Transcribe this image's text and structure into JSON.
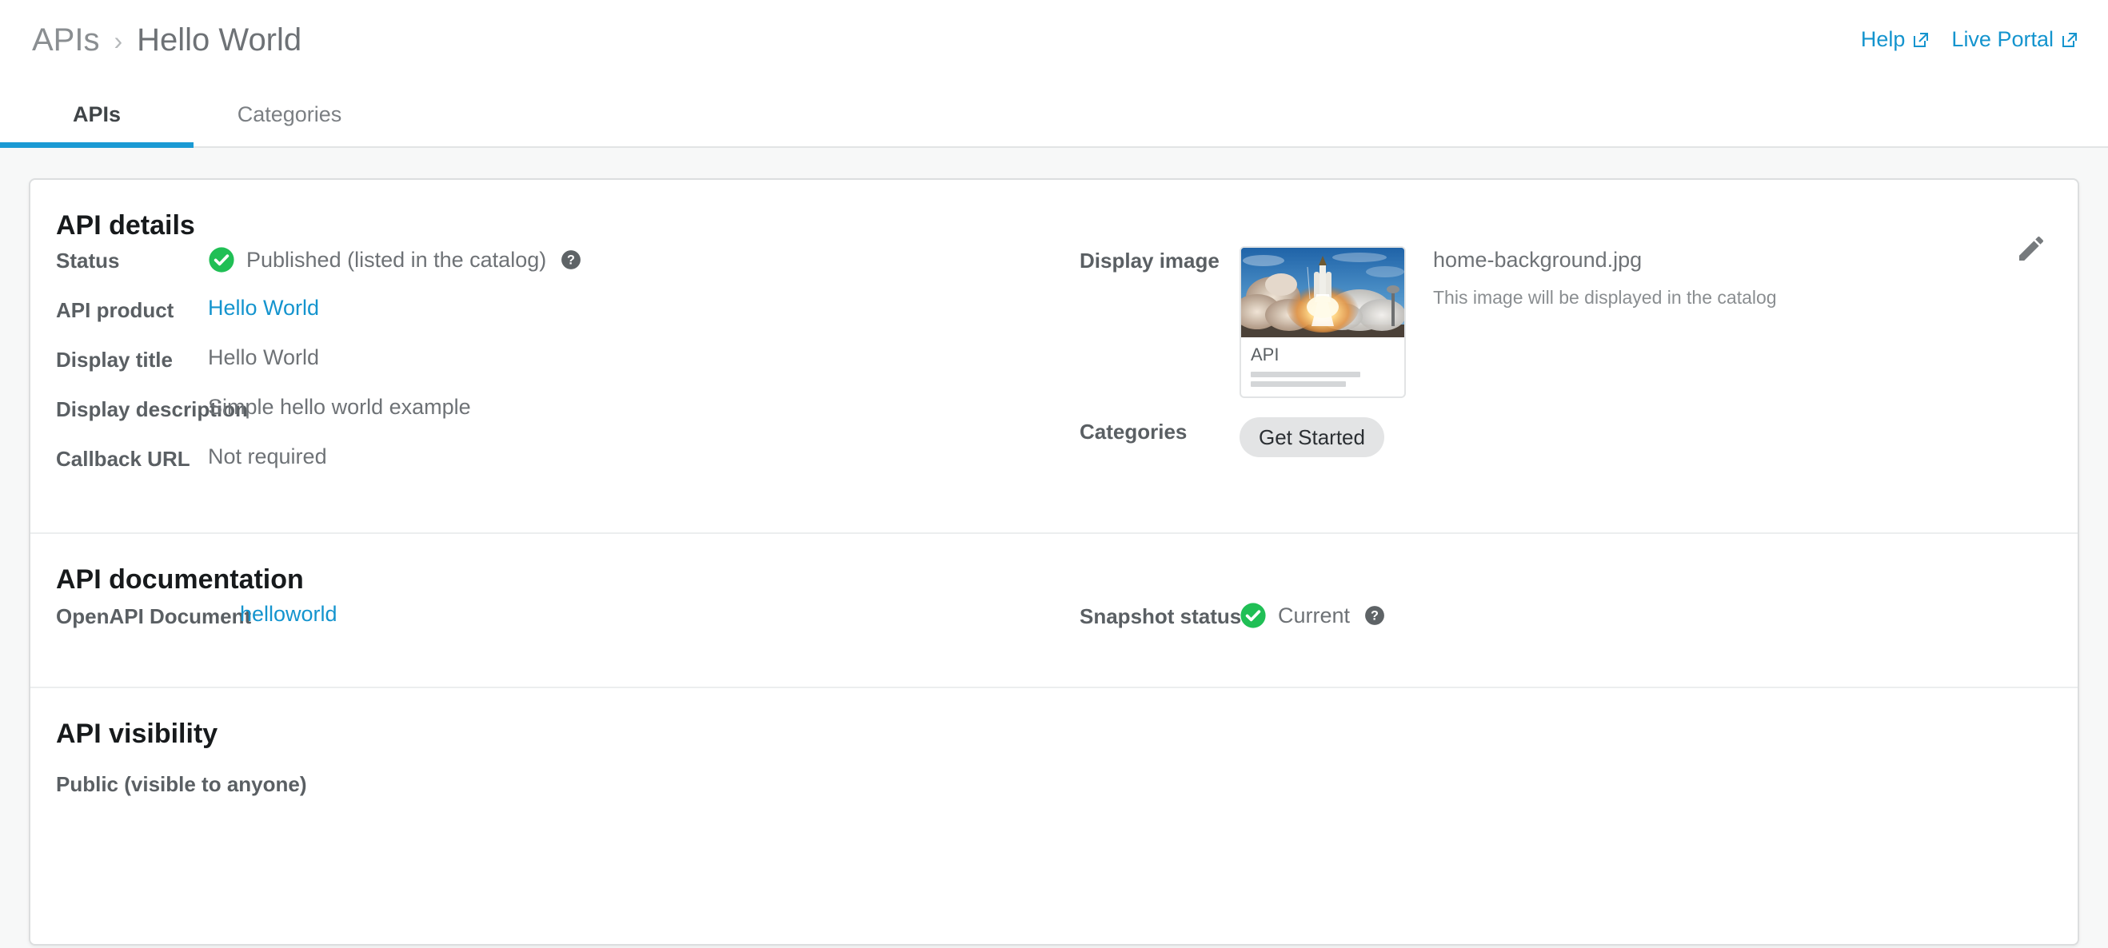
{
  "breadcrumb": {
    "root": "APIs",
    "separator": "›",
    "current": "Hello World"
  },
  "header_links": [
    {
      "label": "Help",
      "icon": "external-link-icon"
    },
    {
      "label": "Live Portal",
      "icon": "external-link-icon"
    }
  ],
  "tabs": [
    {
      "label": "APIs",
      "active": true
    },
    {
      "label": "Categories",
      "active": false
    }
  ],
  "api_details": {
    "title": "API details",
    "edit_icon": "pencil-icon",
    "status": {
      "label": "Status",
      "value": "Published (listed in the catalog)",
      "icon": "check-circle-icon",
      "help_icon": "help-circle-icon"
    },
    "api_product": {
      "label": "API product",
      "value": "Hello World"
    },
    "display_title": {
      "label": "Display title",
      "value": "Hello World"
    },
    "display_description": {
      "label": "Display description",
      "value": "Simple hello world example"
    },
    "callback_url": {
      "label": "Callback URL",
      "value": "Not required"
    },
    "display_image": {
      "label": "Display image",
      "filename": "home-background.jpg",
      "hint": "This image will be displayed in the catalog",
      "thumbnail_title": "API",
      "thumbnail_alt": "rocket-launch-photo"
    },
    "categories": {
      "label": "Categories",
      "items": [
        "Get Started"
      ]
    }
  },
  "api_documentation": {
    "title": "API documentation",
    "openapi_document": {
      "label": "OpenAPI Document",
      "value": "helloworld"
    },
    "snapshot_status": {
      "label": "Snapshot status",
      "value": "Current",
      "icon": "check-circle-icon",
      "help_icon": "help-circle-icon"
    }
  },
  "api_visibility": {
    "title": "API visibility",
    "value": "Public (visible to anyone)"
  },
  "colors": {
    "link": "#1494ce",
    "accent": "#1a9ad4",
    "success": "#20bf55",
    "page_bg": "#f7f8f8",
    "label": "#5a5f63",
    "value": "#6e7276"
  }
}
